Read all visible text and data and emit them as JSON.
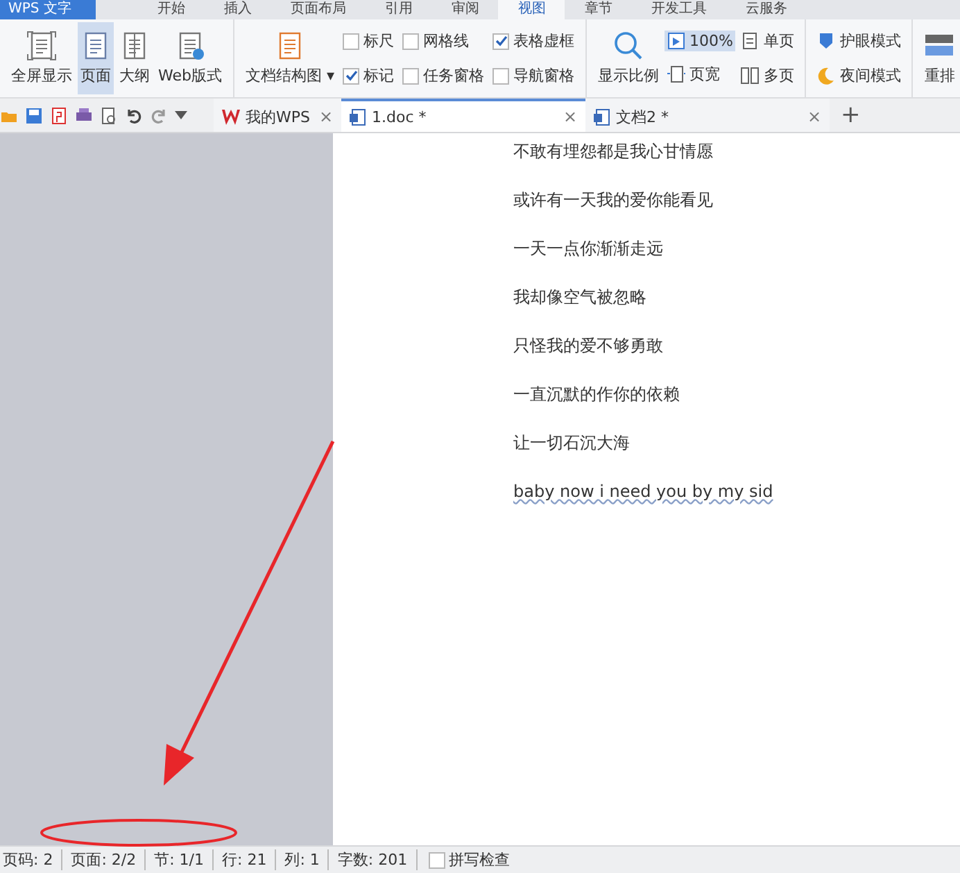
{
  "app_button": {
    "label": "WPS 文字"
  },
  "menu_tabs": [
    {
      "label": "开始",
      "selected": false
    },
    {
      "label": "插入",
      "selected": false
    },
    {
      "label": "页面布局",
      "selected": false
    },
    {
      "label": "引用",
      "selected": false
    },
    {
      "label": "审阅",
      "selected": false
    },
    {
      "label": "视图",
      "selected": true
    },
    {
      "label": "章节",
      "selected": false
    },
    {
      "label": "开发工具",
      "selected": false
    },
    {
      "label": "云服务",
      "selected": false
    }
  ],
  "ribbon": {
    "views": [
      {
        "label": "全屏显示",
        "kind": "fullscreen",
        "selected": false
      },
      {
        "label": "页面",
        "kind": "page",
        "selected": true
      },
      {
        "label": "大纲",
        "kind": "outline",
        "selected": false
      },
      {
        "label": "Web版式",
        "kind": "web",
        "selected": false
      }
    ],
    "doc_map": {
      "label": "文档结构图",
      "caret": "▾"
    },
    "checkboxes": [
      {
        "label": "标尺",
        "checked": false
      },
      {
        "label": "网格线",
        "checked": false
      },
      {
        "label": "表格虚框",
        "checked": true
      },
      {
        "label": "标记",
        "checked": true
      },
      {
        "label": "任务窗格",
        "checked": false
      },
      {
        "label": "导航窗格",
        "checked": false
      }
    ],
    "zoom": {
      "label": "显示比例"
    },
    "zoom_buttons": [
      {
        "label": "100%",
        "kind": "zoom100",
        "selected": true
      },
      {
        "label": "单页",
        "kind": "single",
        "selected": false
      },
      {
        "label": "页宽",
        "kind": "width",
        "selected": false
      },
      {
        "label": "多页",
        "kind": "multi",
        "selected": false
      }
    ],
    "modes": [
      {
        "label": "护眼模式",
        "kind": "eye"
      },
      {
        "label": "夜间模式",
        "kind": "night"
      }
    ],
    "rearrange": {
      "label": "重排"
    }
  },
  "doc_tabs": [
    {
      "label": "我的WPS",
      "kind": "home",
      "selected": false,
      "close": "×"
    },
    {
      "label": "1.doc *",
      "kind": "doc",
      "selected": true,
      "close": "×"
    },
    {
      "label": "文档2 *",
      "kind": "doc",
      "selected": false,
      "close": "×"
    }
  ],
  "new_tab": "+",
  "document": {
    "lines": [
      "不敢有埋怨都是我心甘情愿",
      "或许有一天我的爱你能看见",
      "一天一点你渐渐走远",
      "我却像空气被忽略",
      "只怪我的爱不够勇敢",
      "一直沉默的作你的依赖",
      "让一切石沉大海",
      "baby now i need you by my sid"
    ]
  },
  "status_bar": {
    "items": [
      "页码: 2",
      "页面: 2/2",
      "节: 1/1",
      "行: 21",
      "列: 1",
      "字数: 201"
    ],
    "spellcheck": {
      "label": "拼写检查",
      "checked": false
    }
  }
}
